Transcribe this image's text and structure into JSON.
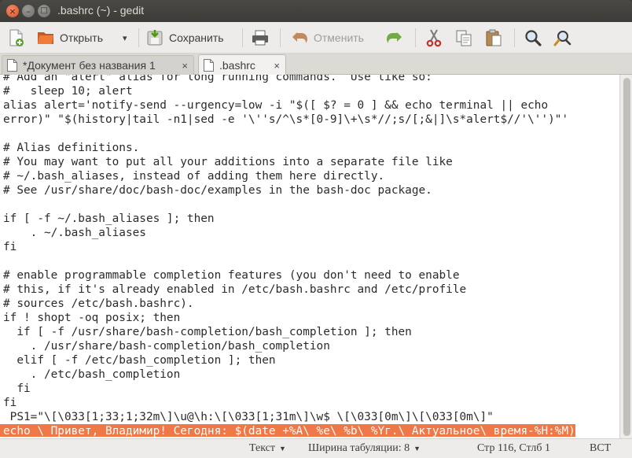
{
  "window": {
    "title": ".bashrc (~) - gedit",
    "close_glyph": "×",
    "min_glyph": "–",
    "max_glyph": "□"
  },
  "toolbar": {
    "new_icon": "new-document-icon",
    "open_label": "Открыть",
    "open_dropdown_glyph": "▾",
    "save_label": "Сохранить",
    "print_icon": "printer-icon",
    "undo_label": "Отменить",
    "redo_icon": "redo-icon",
    "cut_icon": "scissors-icon",
    "copy_icon": "copy-icon",
    "paste_icon": "paste-icon",
    "find_icon": "search-icon",
    "replace_icon": "find-replace-icon"
  },
  "tabs": [
    {
      "label": "*Документ без названия 1",
      "close": "×",
      "active": false
    },
    {
      "label": ".bashrc",
      "close": "×",
      "active": true
    }
  ],
  "editor": {
    "lines": [
      "# Add an \"alert\" alias for long running commands.  Use like so:",
      "#   sleep 10; alert",
      "alias alert='notify-send --urgency=low -i \"$([ $? = 0 ] && echo terminal || echo",
      "error)\" \"$(history|tail -n1|sed -e '\\''s/^\\s*[0-9]\\+\\s*//;s/[;&|]\\s*alert$//'\\'')\"'",
      "",
      "# Alias definitions.",
      "# You may want to put all your additions into a separate file like",
      "# ~/.bash_aliases, instead of adding them here directly.",
      "# See /usr/share/doc/bash-doc/examples in the bash-doc package.",
      "",
      "if [ -f ~/.bash_aliases ]; then",
      "    . ~/.bash_aliases",
      "fi",
      "",
      "# enable programmable completion features (you don't need to enable",
      "# this, if it's already enabled in /etc/bash.bashrc and /etc/profile",
      "# sources /etc/bash.bashrc).",
      "if ! shopt -oq posix; then",
      "  if [ -f /usr/share/bash-completion/bash_completion ]; then",
      "    . /usr/share/bash-completion/bash_completion",
      "  elif [ -f /etc/bash_completion ]; then",
      "    . /etc/bash_completion",
      "  fi",
      "fi",
      " PS1=\"\\[\\033[1;33;1;32m\\]\\u@\\h:\\[\\033[1;31m\\]\\w$ \\[\\033[0m\\]\\[\\033[0m\\]\""
    ],
    "selected_line": "echo \\ Привет, Владимир! Сегодня: $(date +%A\\ %e\\ %b\\ %Yг.\\ Актуальное\\ время-%H:%M)"
  },
  "statusbar": {
    "language": "Текст",
    "tab_width": "Ширина табуляции: 8",
    "position": "Стр 116, Стлб 1",
    "mode": "ВСТ",
    "dropdown_glyph": "▼"
  }
}
